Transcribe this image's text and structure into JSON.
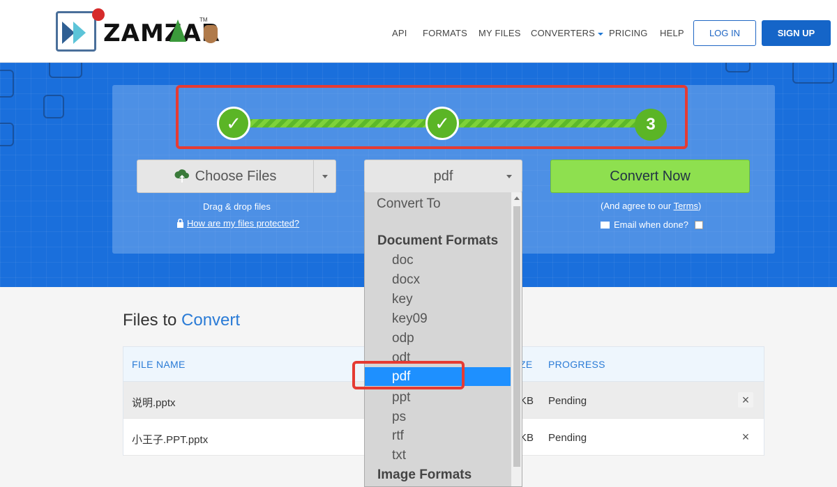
{
  "header": {
    "logo_text": "ZAMZAR",
    "logo_tm": "TM",
    "nav": {
      "api": "API",
      "formats": "FORMATS",
      "my_files": "MY FILES",
      "converters": "CONVERTERS",
      "pricing": "PRICING",
      "help": "HELP"
    },
    "login": "LOG IN",
    "signup": "SIGN UP"
  },
  "steps": {
    "step1": "✓",
    "step2": "✓",
    "step3": "3"
  },
  "upload": {
    "choose_files": "Choose Files",
    "drag_drop": "Drag & drop files",
    "protected_link": "How are my files protected?"
  },
  "format_select": {
    "value": "pdf"
  },
  "convert": {
    "button": "Convert Now",
    "agree_prefix": "(And agree to our ",
    "terms": "Terms",
    "agree_suffix": ")",
    "email_label": "Email when done?"
  },
  "dropdown": {
    "convert_to": "Convert To",
    "document_formats": "Document Formats",
    "options": [
      "doc",
      "docx",
      "key",
      "key09",
      "odp",
      "odt",
      "pdf",
      "ppt",
      "ps",
      "rtf",
      "txt"
    ],
    "image_formats": "Image Formats",
    "selected": "pdf"
  },
  "files": {
    "title_prefix": "Files to ",
    "title_accent": "Convert",
    "columns": {
      "file_name": "FILE NAME",
      "size_fragment": "ZE",
      "progress": "PROGRESS"
    },
    "rows": [
      {
        "name": "说明.pptx",
        "size_fragment": "KB",
        "progress": "Pending"
      },
      {
        "name": "小王子.PPT.pptx",
        "size_fragment": "KB",
        "progress": "Pending"
      }
    ],
    "remove_glyph": "×"
  },
  "colors": {
    "brand_blue": "#1a6fdc",
    "accent_green": "#5bb526",
    "highlight_red": "#e53b33",
    "selection_blue": "#1e90ff"
  }
}
